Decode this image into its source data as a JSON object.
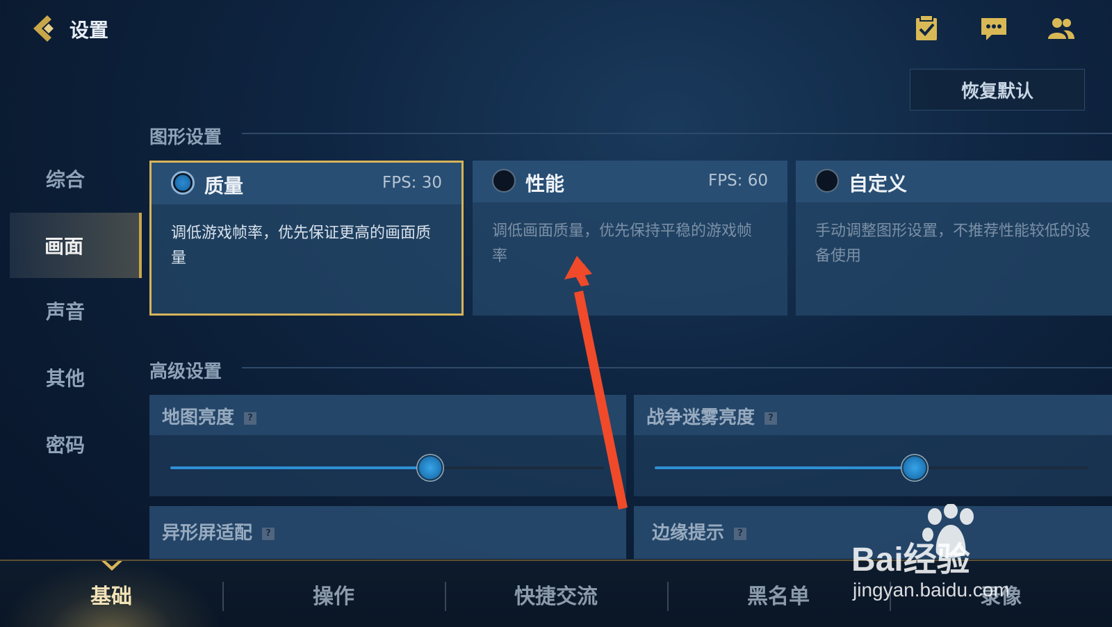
{
  "header": {
    "title": "设置",
    "back_icon": "chevron-left-icon",
    "icons": [
      "calendar-check-icon",
      "chat-bubble-icon",
      "friends-icon"
    ]
  },
  "reset_button": "恢复默认",
  "graphics": {
    "section_title": "图形设置",
    "options": [
      {
        "name": "质量",
        "fps": "FPS: 30",
        "desc": "调低游戏帧率，优先保证更高的画面质量",
        "selected": true
      },
      {
        "name": "性能",
        "fps": "FPS: 60",
        "desc": "调低画面质量，优先保持平稳的游戏帧率",
        "selected": false
      },
      {
        "name": "自定义",
        "fps": "",
        "desc": "手动调整图形设置，不推荐性能较低的设备使用",
        "selected": false
      }
    ]
  },
  "advanced": {
    "section_title": "高级设置",
    "sliders": [
      {
        "label": "地图亮度",
        "help": "?",
        "value": 0.6
      },
      {
        "label": "战争迷雾亮度",
        "help": "?",
        "value": 0.6
      }
    ],
    "toggles": [
      {
        "label": "异形屏适配",
        "help": "?"
      },
      {
        "label": "边缘提示",
        "help": "?"
      }
    ]
  },
  "sidebar": {
    "items": [
      {
        "label": "综合",
        "active": false
      },
      {
        "label": "画面",
        "active": true
      },
      {
        "label": "声音",
        "active": false
      },
      {
        "label": "其他",
        "active": false
      },
      {
        "label": "密码",
        "active": false
      }
    ]
  },
  "bottom_tabs": [
    {
      "label": "基础",
      "active": true
    },
    {
      "label": "操作",
      "active": false
    },
    {
      "label": "快捷交流",
      "active": false
    },
    {
      "label": "黑名单",
      "active": false
    },
    {
      "label": "录像",
      "active": false
    }
  ],
  "watermark": {
    "brand": "Bai经验",
    "url": "jingyan.baidu.com"
  },
  "colors": {
    "accent_gold": "#d8b45a",
    "slider_blue": "#2f8fd4",
    "annotation_arrow": "#f04a2a"
  }
}
